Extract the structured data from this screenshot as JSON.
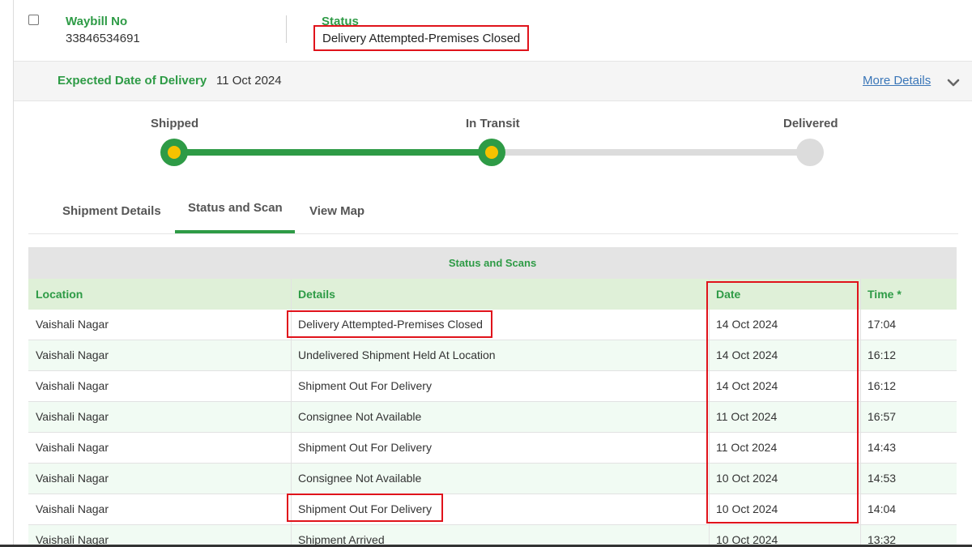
{
  "header": {
    "waybill_label": "Waybill No",
    "waybill_value": "33846534691",
    "status_label": "Status",
    "status_value": "Delivery Attempted-Premises Closed"
  },
  "edd": {
    "label": "Expected Date of Delivery",
    "value": "11 Oct 2024",
    "more_link": "More Details"
  },
  "progress": {
    "steps": [
      "Shipped",
      "In Transit",
      "Delivered"
    ],
    "completed_steps": 2
  },
  "tabs": [
    {
      "label": "Shipment Details",
      "active": false
    },
    {
      "label": "Status and Scan",
      "active": true
    },
    {
      "label": "View Map",
      "active": false
    }
  ],
  "table": {
    "title": "Status and Scans",
    "columns": [
      "Location",
      "Details",
      "Date",
      "Time *"
    ],
    "rows": [
      [
        "Vaishali Nagar",
        "Delivery Attempted-Premises Closed",
        "14 Oct 2024",
        "17:04"
      ],
      [
        "Vaishali Nagar",
        "Undelivered Shipment Held At Location",
        "14 Oct 2024",
        "16:12"
      ],
      [
        "Vaishali Nagar",
        "Shipment Out For Delivery",
        "14 Oct 2024",
        "16:12"
      ],
      [
        "Vaishali Nagar",
        "Consignee Not Available",
        "11 Oct 2024",
        "16:57"
      ],
      [
        "Vaishali Nagar",
        "Shipment Out For Delivery",
        "11 Oct 2024",
        "14:43"
      ],
      [
        "Vaishali Nagar",
        "Consignee Not Available",
        "10 Oct 2024",
        "14:53"
      ],
      [
        "Vaishali Nagar",
        "Shipment Out For Delivery",
        "10 Oct 2024",
        "14:04"
      ],
      [
        "Vaishali Nagar",
        "Shipment Arrived",
        "10 Oct 2024",
        "13:32"
      ]
    ]
  },
  "colors": {
    "brand_green": "#2e9b46",
    "highlight_red": "#e0131b",
    "progress_yellow": "#f6c200",
    "link_blue": "#3a76b8"
  },
  "icons": {
    "expand": "chevron-down-icon",
    "select": "checkbox"
  }
}
